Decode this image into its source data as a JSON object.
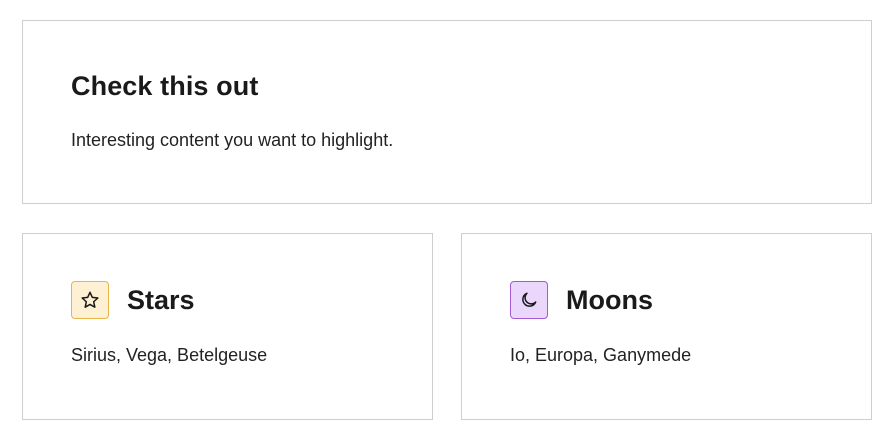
{
  "hero": {
    "title": "Check this out",
    "body": "Interesting content you want to highlight."
  },
  "cards": [
    {
      "title": "Stars",
      "body": "Sirius, Vega, Betelgeuse",
      "icon": "star-icon",
      "icon_bg": "#fdf0d3",
      "icon_border": "#e9b54a"
    },
    {
      "title": "Moons",
      "body": "Io, Europa, Ganymede",
      "icon": "moon-icon",
      "icon_bg": "#ead7fb",
      "icon_border": "#a45ad6"
    }
  ],
  "colors": {
    "card_border": "#cfcfcf",
    "text": "#1a1a1a"
  }
}
